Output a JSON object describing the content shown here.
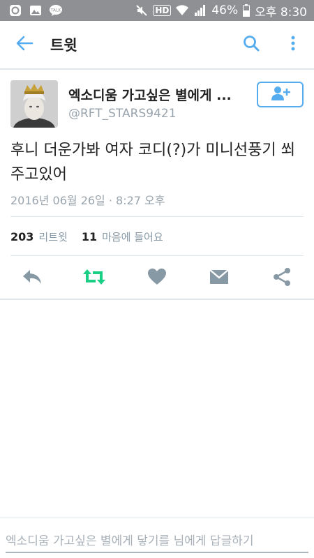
{
  "status_bar": {
    "battery": "46%",
    "time": "오후 8:30",
    "hd": "HD",
    "talk": "TALK"
  },
  "app_bar": {
    "title": "트윗",
    "icons": [
      "back-arrow-icon",
      "search-icon",
      "more-vert-icon"
    ]
  },
  "tweet": {
    "display_name": "엑소디움 가고싶은 별에게 ...",
    "handle": "@RFT_STARS9421",
    "text": "후니 더운가봐 여자 코디(?)가 미니선풍기 쐬주고있어",
    "timestamp": "2016년 06월 26일 · 8:27 오후",
    "retweet_count": "203",
    "retweet_label": "리트윗",
    "like_count": "11",
    "like_label": "마음에 들어요"
  },
  "actions": [
    "reply-icon",
    "retweet-icon",
    "heart-icon",
    "message-icon",
    "share-icon"
  ],
  "reply_box": {
    "placeholder": "엑소디움 가고싶은 별에게 닿기를 님에게 답글하기"
  },
  "colors": {
    "accent": "#55acee",
    "retweet_green": "#19cf86",
    "icon_gray": "#8899a6",
    "status_bar": "#8e9094"
  }
}
